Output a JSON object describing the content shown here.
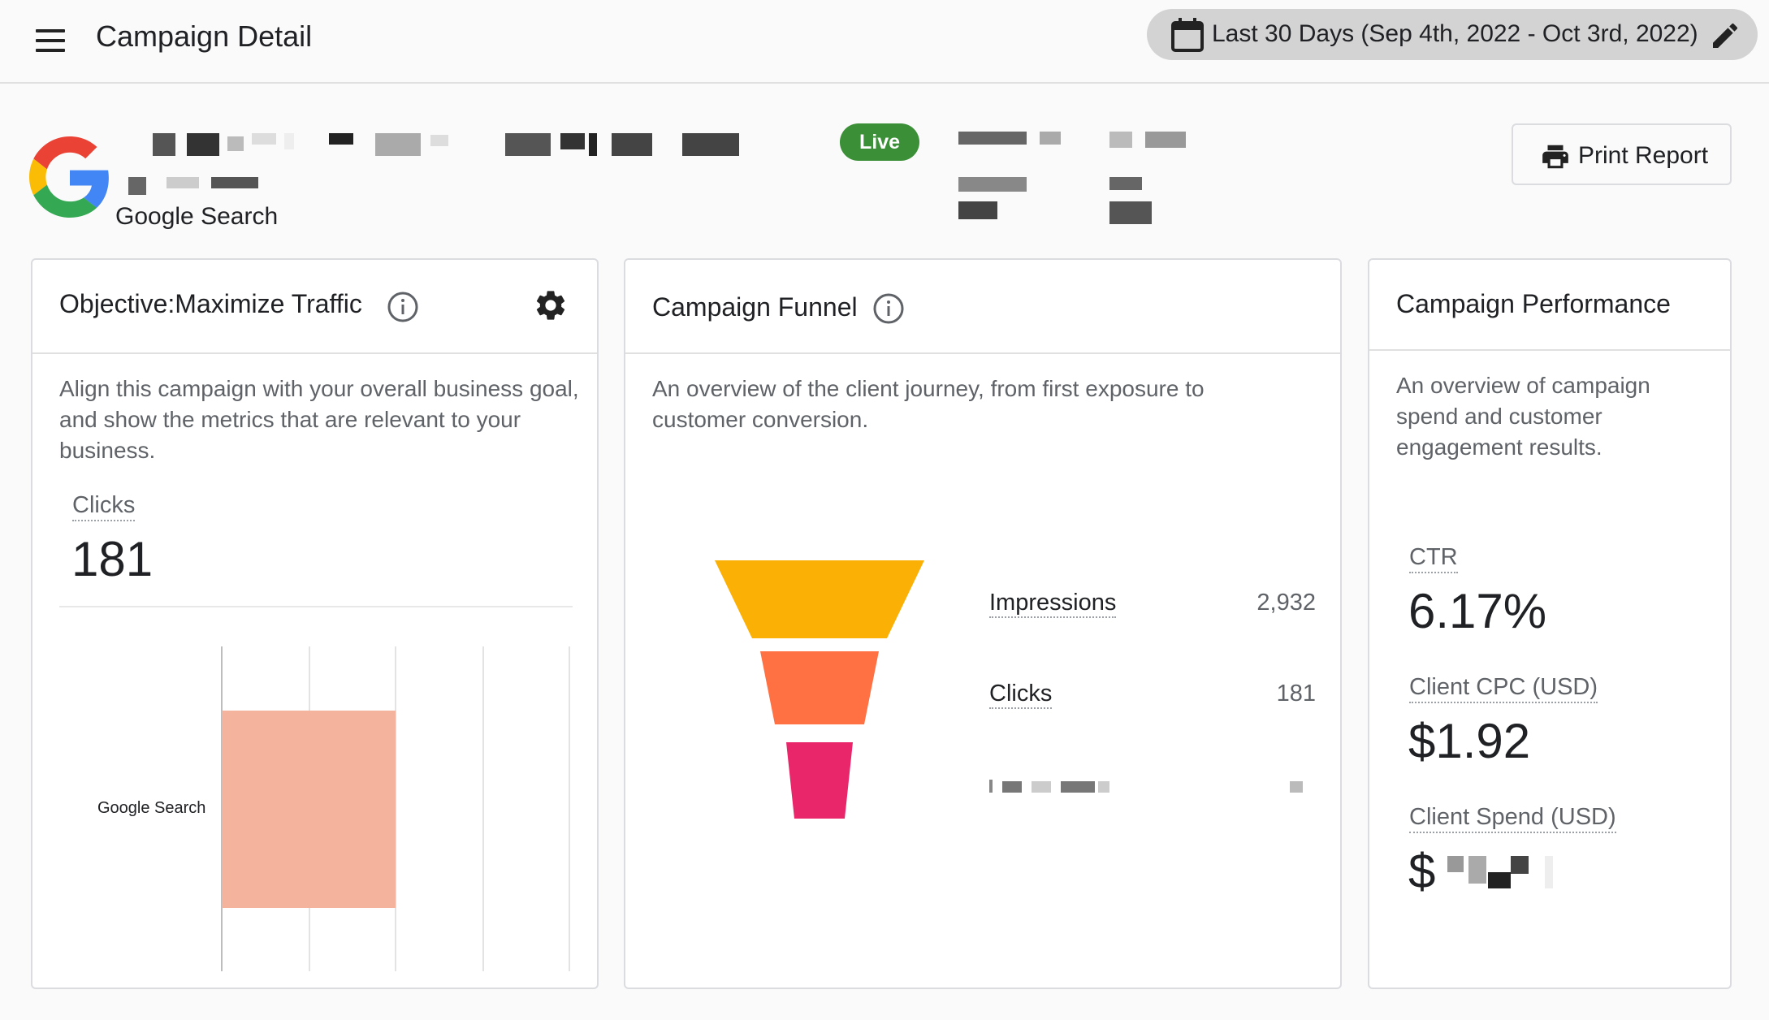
{
  "app_bar": {
    "title": "Campaign Detail",
    "date_range": "Last 30 Days (Sep 4th, 2022 - Oct 3rd, 2022)"
  },
  "campaign": {
    "source": "Google Search",
    "status": "Live",
    "print_label": "Print Report"
  },
  "objective_card": {
    "title": "Objective:Maximize Traffic",
    "description": "Align this campaign with your overall business goal, and show the metrics that are relevant to your business.",
    "metric_label": "Clicks",
    "metric_value": "181",
    "chart_category": "Google Search",
    "chart_value_fraction": 0.5,
    "bar_color": "#f3b39d"
  },
  "funnel_card": {
    "title": "Campaign Funnel",
    "description": "An overview of the client journey, from first exposure to customer conversion.",
    "stages": [
      {
        "label": "Impressions",
        "value": "2,932",
        "color": "#fbb005"
      },
      {
        "label": "Clicks",
        "value": "181",
        "color": "#ff7043"
      },
      {
        "label": "",
        "value": "",
        "color": "#e9266a"
      }
    ]
  },
  "performance_card": {
    "title": "Campaign Performance",
    "description": "An overview of campaign spend and customer engagement results.",
    "metrics": [
      {
        "label": "CTR",
        "value": "6.17%"
      },
      {
        "label": "Client CPC (USD)",
        "value": "$1.92"
      },
      {
        "label": "Client Spend (USD)",
        "value": "$"
      }
    ]
  },
  "colors": {
    "live_badge": "#3a8f37",
    "date_chip": "#d3d3d3"
  },
  "icons": [
    "menu-icon",
    "calendar-icon",
    "edit-pencil-icon",
    "google-logo",
    "printer-icon",
    "info-icon",
    "gear-icon"
  ]
}
